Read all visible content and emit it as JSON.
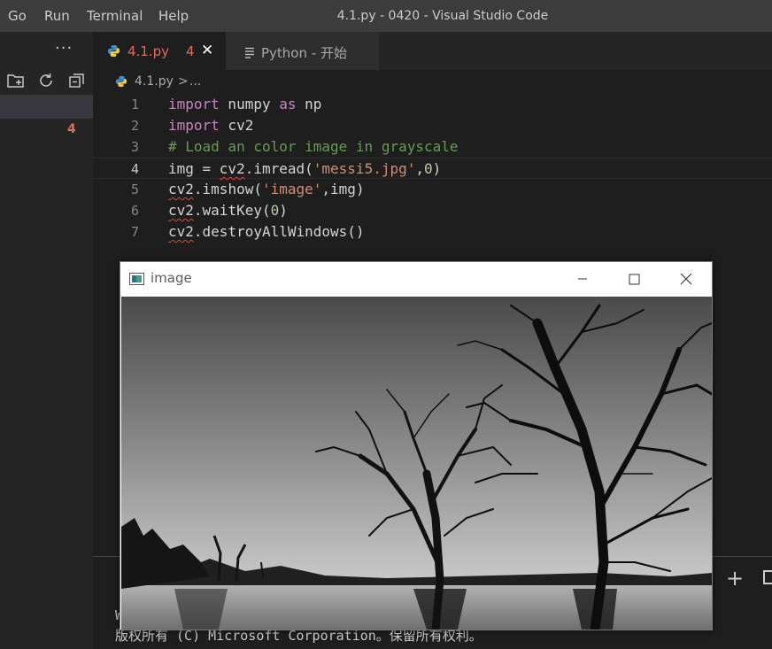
{
  "titlebar": {
    "menus": [
      "Go",
      "Run",
      "Terminal",
      "Help"
    ],
    "title": "4.1.py - 0420 - Visual Studio Code"
  },
  "sidebar": {
    "more": "···",
    "problem_count": "4"
  },
  "tabs": [
    {
      "label": "4.1.py",
      "badge": "4",
      "close": "✕"
    },
    {
      "label": "Python - 开始"
    }
  ],
  "breadcrumb": {
    "file": "4.1.py",
    "sep": ">",
    "rest": "..."
  },
  "editor": {
    "lines": [
      {
        "n": "1",
        "parts": [
          {
            "t": "import",
            "c": "kw"
          },
          {
            "t": " numpy "
          },
          {
            "t": "as",
            "c": "kw"
          },
          {
            "t": " np"
          }
        ]
      },
      {
        "n": "2",
        "parts": [
          {
            "t": "import",
            "c": "kw"
          },
          {
            "t": " cv2"
          }
        ]
      },
      {
        "n": "3",
        "parts": [
          {
            "t": "# Load an color image in grayscale",
            "c": "cmt"
          }
        ]
      },
      {
        "n": "4",
        "parts": [
          {
            "t": "img = "
          },
          {
            "t": "cv2",
            "c": "squiggle"
          },
          {
            "t": ".imread("
          },
          {
            "t": "'messi5.jpg'",
            "c": "str"
          },
          {
            "t": ","
          },
          {
            "t": "0",
            "c": "num"
          },
          {
            "t": ")"
          }
        ]
      },
      {
        "n": "5",
        "parts": [
          {
            "t": "cv2",
            "c": "squiggle"
          },
          {
            "t": ".imshow("
          },
          {
            "t": "'image'",
            "c": "str"
          },
          {
            "t": ",img)"
          }
        ]
      },
      {
        "n": "6",
        "parts": [
          {
            "t": "cv2",
            "c": "squiggle"
          },
          {
            "t": ".waitKey("
          },
          {
            "t": "0",
            "c": "num"
          },
          {
            "t": ")"
          }
        ]
      },
      {
        "n": "7",
        "parts": [
          {
            "t": "cv2",
            "c": "squiggle"
          },
          {
            "t": ".destroyAllWindows()"
          }
        ]
      }
    ],
    "current_line": "4"
  },
  "terminal": {
    "line1": "W",
    "line2": "版权所有 (C) Microsoft Corporation。保留所有权利。",
    "new_terminal": "+"
  },
  "cv_window": {
    "title": "image"
  },
  "colors": {
    "keyword": "#c586c0",
    "string": "#ce9178",
    "comment": "#6a9955",
    "number": "#b5cea8",
    "error": "#e06c5c"
  }
}
